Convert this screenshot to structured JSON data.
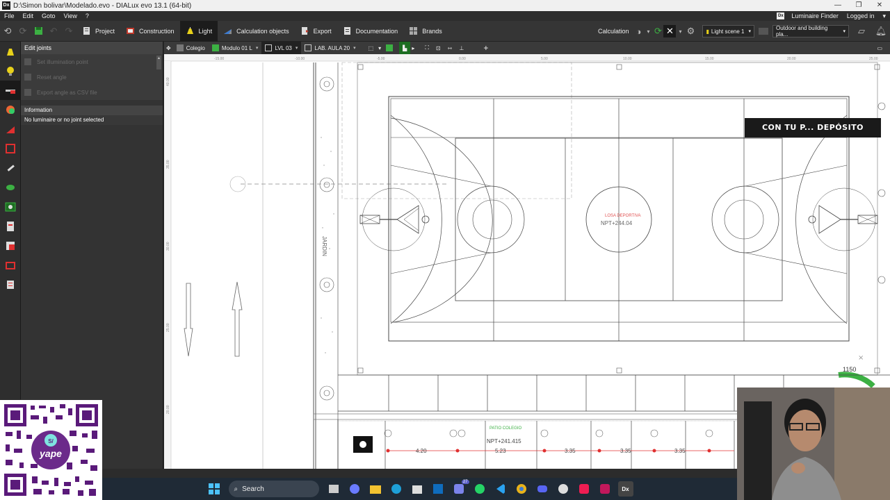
{
  "window": {
    "title": "D:\\Simon bolivar\\Modelado.evo - DIALux evo 13.1  (64-bit)",
    "app_icon": "Dx"
  },
  "menu": {
    "items": [
      "File",
      "Edit",
      "Goto",
      "View",
      "?"
    ],
    "luminaire_finder": "Luminaire Finder",
    "logged_in": "Logged in"
  },
  "toolbar": {
    "project": "Project",
    "construction": "Construction",
    "light": "Light",
    "calculation_objects": "Calculation objects",
    "export": "Export",
    "documentation": "Documentation",
    "brands": "Brands",
    "calculation": "Calculation",
    "light_scene": "Light scene 1",
    "outdoor": "Outdoor and building pla..."
  },
  "panel": {
    "header": "Edit joints",
    "items": [
      "Set illumination point",
      "Reset angle",
      "Export angle as CSV file"
    ],
    "info_header": "Information",
    "info_text": "No luminaire or no joint selected"
  },
  "viewport_toolbar": {
    "site": "Colegio",
    "building": "Modulo 01 L",
    "level": "LVL 03",
    "room": "LAB. AULA 20"
  },
  "drawing": {
    "ruler_top": [
      "-15.00",
      "-10.00",
      "-5.00",
      "0.00",
      "5.00",
      "10.00",
      "15.00",
      "20.00",
      "25.00"
    ],
    "ruler_left": [
      "40.00",
      "35.00",
      "30.00",
      "25.00",
      "20.00"
    ],
    "garden_label": "JARDIN",
    "court_label": "LOSA DEPORTIVA",
    "court_level": "NPT+244.04",
    "bottom_level": "NPT+241.415",
    "bottom_level_label": "PATIO COLEGIO",
    "dims": [
      "4.20",
      "5.23",
      "3.35",
      "3.35",
      "3.35"
    ],
    "banner": "CON TU P... DEPÓSITO",
    "right_value": "1150"
  },
  "taskbar": {
    "search": "Search",
    "badge_count": "27"
  },
  "colors": {
    "accent_green": "#3cb043",
    "toolbar_bg": "#353535"
  }
}
